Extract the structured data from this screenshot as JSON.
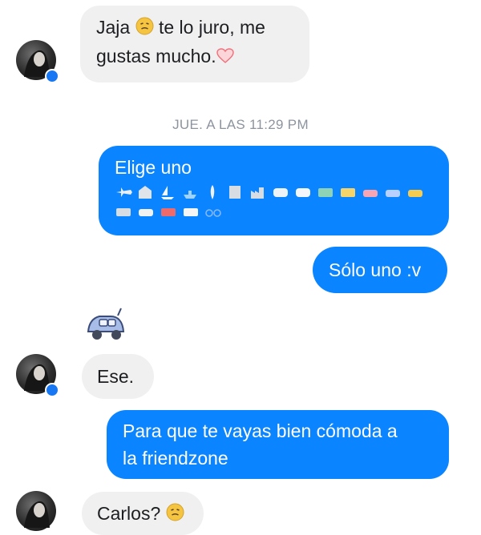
{
  "messages": [
    {
      "side": "in",
      "line1_before": "Jaja",
      "line1_after": "te lo juro, me",
      "line2": "gustas mucho."
    },
    {
      "type": "timestamp",
      "text": "JUE. A LAS 11:29 PM"
    },
    {
      "side": "out",
      "text": "Elige uno",
      "emoji_row1": [
        "airplane-icon",
        "house-icon",
        "sailboat-icon",
        "ship-icon",
        "rocket-icon",
        "building-icon",
        "factory-icon",
        "train-icon",
        "train-icon",
        "tram-icon",
        "bus-icon",
        "car-icon",
        "car-icon",
        "taxi-icon"
      ],
      "emoji_row2": [
        "truck-icon",
        "car-icon",
        "fire-engine-icon",
        "van-icon",
        "bicycle-icon"
      ]
    },
    {
      "side": "out",
      "text": "Sólo uno :v"
    },
    {
      "side": "in",
      "text": "Ese."
    },
    {
      "side": "out",
      "line1": "Para que te vayas bien cómoda a",
      "line2": "la friendzone"
    },
    {
      "side": "in",
      "text": "Carlos?"
    }
  ],
  "colors": {
    "outgoing_bubble": "#0a84ff",
    "incoming_bubble": "#f1f0f0",
    "timestamp": "#8d949e",
    "messenger_badge": "#1877f2"
  }
}
